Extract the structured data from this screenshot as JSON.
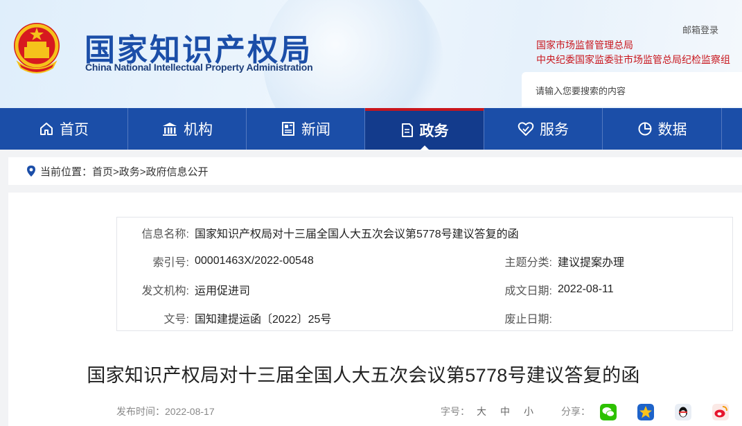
{
  "header": {
    "logo_cn": "国家知识产权局",
    "logo_en": "China National Intellectual Property Administration",
    "login": "邮箱登录",
    "links": [
      "国家市场监督管理总局",
      "中央纪委国家监委驻市场监管总局纪检监察组"
    ],
    "search_placeholder": "请输入您要搜索的内容"
  },
  "nav": [
    {
      "label": "首页",
      "icon": "home-icon"
    },
    {
      "label": "机构",
      "icon": "institution-icon"
    },
    {
      "label": "新闻",
      "icon": "news-icon"
    },
    {
      "label": "政务",
      "icon": "document-icon",
      "active": true
    },
    {
      "label": "服务",
      "icon": "service-icon"
    },
    {
      "label": "数据",
      "icon": "pie-chart-icon"
    }
  ],
  "breadcrumb": {
    "prefix": "当前位置：",
    "path": "首页>政务>政府信息公开"
  },
  "info": {
    "name_label": "信息名称:",
    "name": "国家知识产权局对十三届全国人大五次会议第5778号建议答复的函",
    "index_label": "索引号:",
    "index": "00001463X/2022-00548",
    "topic_label": "主题分类:",
    "topic": "建议提案办理",
    "issuer_label": "发文机构:",
    "issuer": "运用促进司",
    "date_label": "成文日期:",
    "date": "2022-08-11",
    "docno_label": "文号:",
    "docno": "国知建提运函〔2022〕25号",
    "expire_label": "废止日期:",
    "expire": ""
  },
  "article": {
    "title": "国家知识产权局对十三届全国人大五次会议第5778号建议答复的函",
    "publish": "发布时间：2022-08-17",
    "font_label": "字号：",
    "font_sizes": [
      "大",
      "中",
      "小"
    ],
    "share_label": "分享："
  },
  "colors": {
    "brand_blue": "#1b4ea8",
    "accent_red": "#c8161d"
  }
}
